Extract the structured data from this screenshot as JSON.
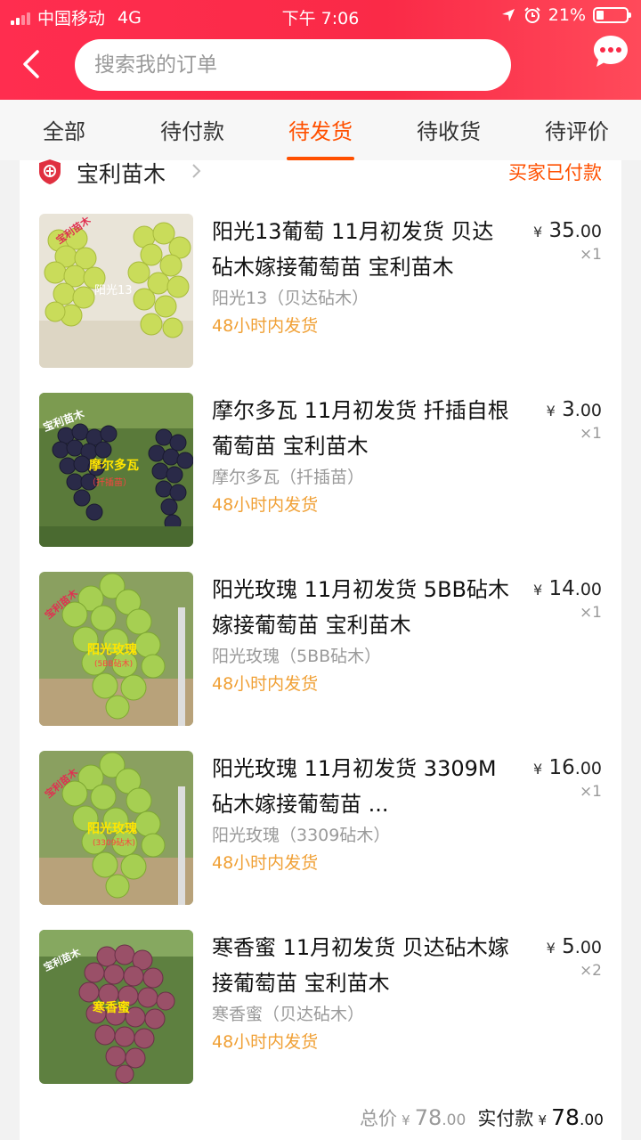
{
  "status_bar": {
    "carrier": "中国移动",
    "network": "4G",
    "time": "下午 7:06",
    "battery": "21%"
  },
  "search": {
    "placeholder": "搜索我的订单"
  },
  "tabs": [
    {
      "label": "全部"
    },
    {
      "label": "待付款"
    },
    {
      "label": "待发货"
    },
    {
      "label": "待收货"
    },
    {
      "label": "待评价"
    }
  ],
  "active_tab": "待发货",
  "colors": {
    "brand": "#fa2a47",
    "accent": "#ff5000",
    "ship": "#f0a035"
  },
  "order": {
    "shop_name": "宝利苗木",
    "status": "买家已付款",
    "items": [
      {
        "title": "阳光13葡萄  11月初发货 贝达砧木嫁接葡萄苗 宝利苗木",
        "sku": "阳光13（贝达砧木）",
        "ship": "48小时内发货",
        "price_int": "35",
        "price_dec": ".00",
        "qty": "×1",
        "thumb_label": "阳光13",
        "thumb_watermark": "宝利苗木"
      },
      {
        "title": "摩尔多瓦  11月初发货 扦插自根 葡萄苗 宝利苗木",
        "sku": "摩尔多瓦（扦插苗）",
        "ship": "48小时内发货",
        "price_int": "3",
        "price_dec": ".00",
        "qty": "×1",
        "thumb_label": "摩尔多瓦",
        "thumb_sublabel": "（扦插苗）",
        "thumb_watermark": "宝利苗木"
      },
      {
        "title": "阳光玫瑰  11月初发货 5BB砧木 嫁接葡萄苗 宝利苗木",
        "sku": "阳光玫瑰（5BB砧木）",
        "ship": "48小时内发货",
        "price_int": "14",
        "price_dec": ".00",
        "qty": "×1",
        "thumb_label": "阳光玫瑰",
        "thumb_sublabel": "(5BB砧木)",
        "thumb_watermark": "宝利苗木"
      },
      {
        "title": "阳光玫瑰  11月初发货 3309M砧木嫁接葡萄苗 ...",
        "sku": "阳光玫瑰（3309砧木）",
        "ship": "48小时内发货",
        "price_int": "16",
        "price_dec": ".00",
        "qty": "×1",
        "thumb_label": "阳光玫瑰",
        "thumb_sublabel": "(3309砧木)",
        "thumb_watermark": "宝利苗木"
      },
      {
        "title": "寒香蜜  11月初发货 贝达砧木嫁接葡萄苗 宝利苗木",
        "sku": "寒香蜜（贝达砧木）",
        "ship": "48小时内发货",
        "price_int": "5",
        "price_dec": ".00",
        "qty": "×2",
        "thumb_label": "寒香蜜",
        "thumb_watermark": "宝利苗木"
      }
    ],
    "total_label": "总价",
    "total_int": "78",
    "total_dec": ".00",
    "paid_label": "实付款",
    "paid_int": "78",
    "paid_dec": ".00",
    "currency": "¥"
  }
}
